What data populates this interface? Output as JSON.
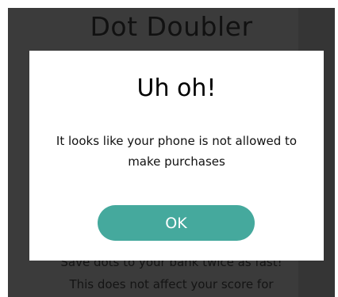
{
  "app": {
    "title": "Dot Doubler",
    "description_line_1": "Save dots to your bank twice as fast!",
    "description_line_2": "This does not affect your score for"
  },
  "dialog": {
    "title": "Uh oh!",
    "message": "It looks like your phone is not allowed to make purchases",
    "ok_label": "OK"
  },
  "colors": {
    "overlay": "#3b3b3b",
    "dialog_background": "#ffffff",
    "button": "#45a99d",
    "button_text": "#ffffff"
  }
}
